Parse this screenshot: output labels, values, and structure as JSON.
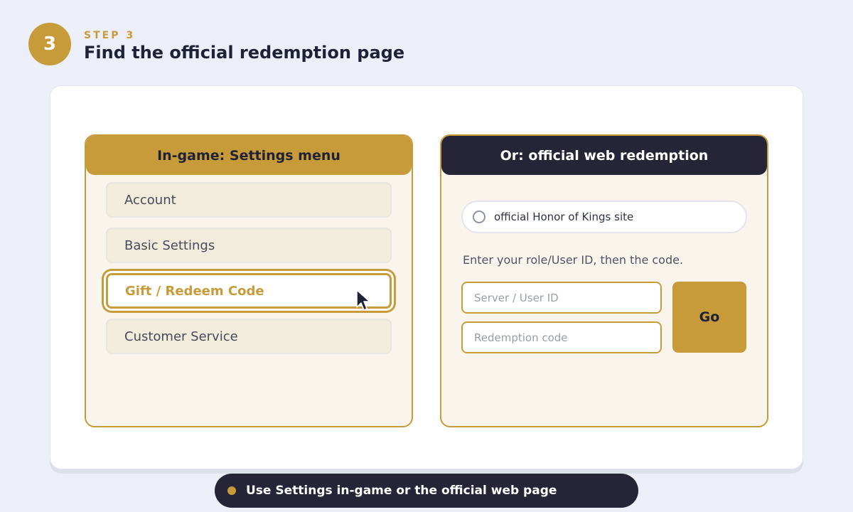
{
  "header": {
    "step_number": "3",
    "eyebrow": "STEP 3",
    "title": "Find the official redemption page"
  },
  "settings_panel": {
    "title": "In-game: Settings menu",
    "items": [
      {
        "label": "Account",
        "highlighted": false
      },
      {
        "label": "Basic Settings",
        "highlighted": false
      },
      {
        "label": "Gift / Redeem Code",
        "highlighted": true
      },
      {
        "label": "Customer Service",
        "highlighted": false
      }
    ]
  },
  "web_panel": {
    "title": "Or: official web redemption",
    "site_option": "official Honor of Kings site",
    "instruction": "Enter your role/User ID, then the code.",
    "user_id_placeholder": "Server / User ID",
    "code_placeholder": "Redemption code",
    "go_label": "Go"
  },
  "caption": {
    "text": "Use Settings in-game or the official web page"
  },
  "colors": {
    "accent_gold": "#C89B3A",
    "dark_navy": "#262437",
    "background": "#ECEFF7",
    "panel_cream": "#FAF5EC"
  },
  "icons": {
    "cursor": "mouse-pointer-icon",
    "radio": "radio-unselected-icon",
    "caption_bullet": "dot-icon"
  }
}
